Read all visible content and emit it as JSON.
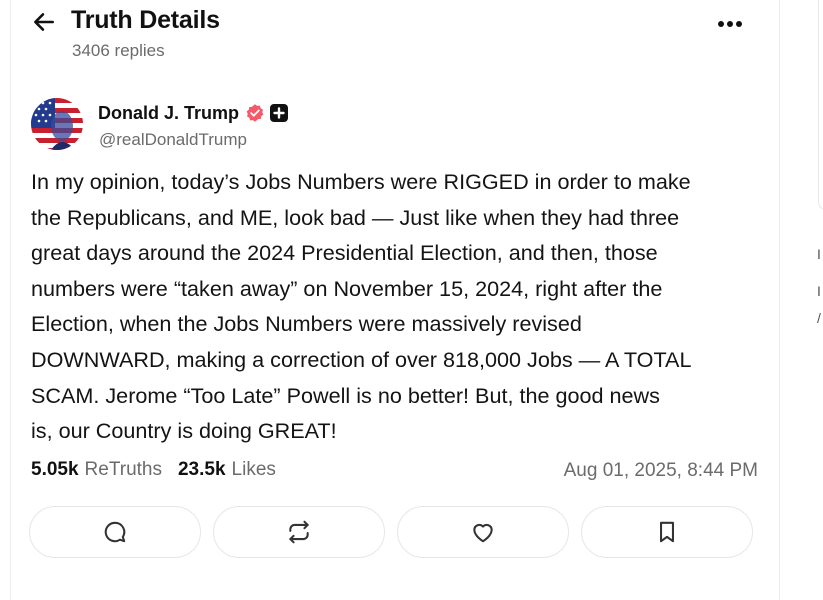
{
  "header": {
    "title": "Truth Details",
    "replies": "3406 replies",
    "icons": {
      "back": "arrow-left-icon",
      "more": "more-horizontal-icon"
    }
  },
  "post": {
    "author_name": "Donald J. Trump",
    "handle": "@realDonaldTrump",
    "verified_color": "#f35b6b",
    "body": "In my opinion, today’s Jobs Numbers were RIGGED in order to make\nthe Republicans, and ME, look bad — Just like when they had three\ngreat days around the 2024 Presidential Election, and then, those\nnumbers were “taken away” on November 15, 2024, right after the\nElection, when the Jobs Numbers were massively revised\nDOWNWARD, making a correction of over 818,000 Jobs — A TOTAL\nSCAM. Jerome “Too Late” Powell is no better! But, the good news\nis, our Country is doing GREAT!",
    "retruths_count": "5.05k",
    "retruths_label": "ReTruths",
    "likes_count": "23.5k",
    "likes_label": "Likes",
    "timestamp": "Aug 01, 2025, 8:44 PM"
  },
  "actions": [
    {
      "name": "reply",
      "icon": "reply-bubble-icon"
    },
    {
      "name": "retruth",
      "icon": "repost-icon"
    },
    {
      "name": "like",
      "icon": "heart-icon"
    },
    {
      "name": "bookmark",
      "icon": "bookmark-icon"
    }
  ],
  "side": {
    "text_1": "I",
    "text_2": "I",
    "text_3": "/"
  },
  "colors": {
    "muted_text": "#6b6b6b",
    "border": "#e6e6e6",
    "verified_badge": "#f35b6b"
  }
}
